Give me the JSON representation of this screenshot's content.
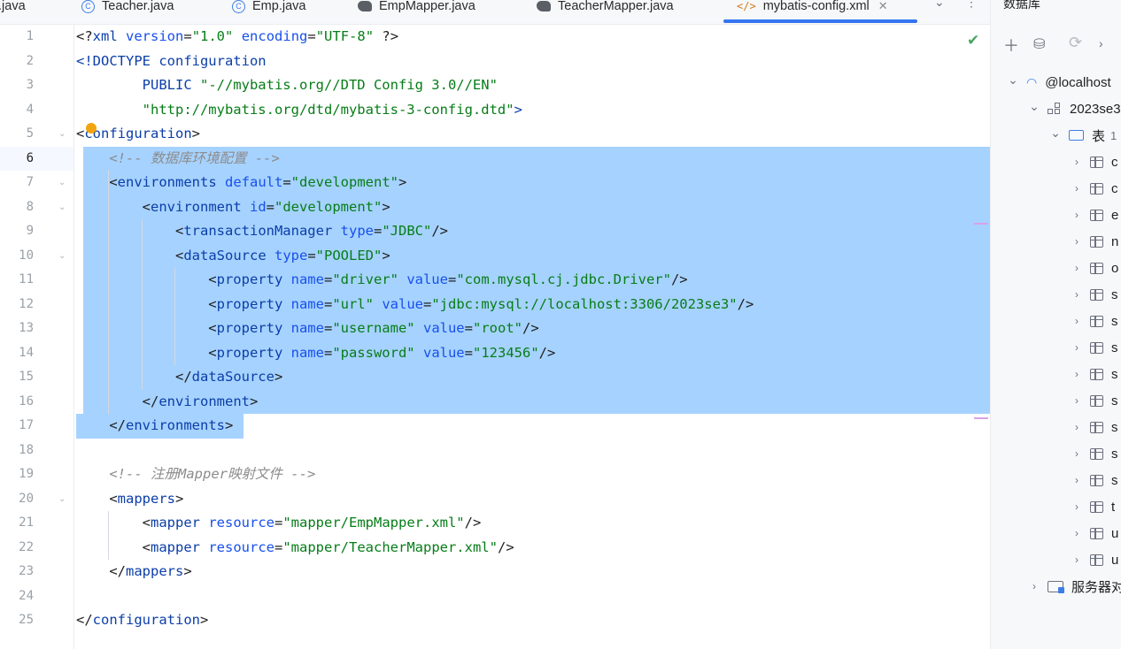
{
  "tabs": [
    {
      "label": "t.java",
      "icon": "java-class-icon"
    },
    {
      "label": "Teacher.java",
      "icon": "class-icon"
    },
    {
      "label": "Emp.java",
      "icon": "class-icon"
    },
    {
      "label": "EmpMapper.java",
      "icon": "mybatis-icon"
    },
    {
      "label": "TeacherMapper.java",
      "icon": "mybatis-icon"
    },
    {
      "label": "mybatis-config.xml",
      "icon": "xml-icon",
      "active": true
    }
  ],
  "code": [
    {
      "n": "1",
      "tokens": [
        [
          "t-tag",
          "<?"
        ],
        [
          "t-name",
          "xml"
        ],
        [
          "t-tag",
          " "
        ],
        [
          "t-attr",
          "version"
        ],
        [
          "t-tag",
          "="
        ],
        [
          "t-val",
          "\"1.0\""
        ],
        [
          "t-tag",
          " "
        ],
        [
          "t-attr",
          "encoding"
        ],
        [
          "t-tag",
          "="
        ],
        [
          "t-val",
          "\"UTF-8\""
        ],
        [
          "t-tag",
          " ?>"
        ]
      ]
    },
    {
      "n": "2",
      "tokens": [
        [
          "t-name",
          "<!DOCTYPE configuration"
        ]
      ]
    },
    {
      "n": "3",
      "tokens": [
        [
          "t-name",
          "        PUBLIC "
        ],
        [
          "t-val",
          "\"-//mybatis.org//DTD Config 3.0//EN\""
        ]
      ]
    },
    {
      "n": "4",
      "tokens": [
        [
          "t-tag",
          "        "
        ],
        [
          "t-val",
          "\"http://mybatis.org/dtd/mybatis-3-config.dtd\""
        ],
        [
          "t-name",
          ">"
        ]
      ]
    },
    {
      "n": "5",
      "tokens": [
        [
          "t-tag",
          "<"
        ],
        [
          "t-name",
          "configuration"
        ],
        [
          "t-tag",
          ">"
        ]
      ]
    },
    {
      "n": "6",
      "tokens": [
        [
          "t-com",
          "    <!-- 数据库环境配置 -->"
        ]
      ]
    },
    {
      "n": "7",
      "tokens": [
        [
          "t-tag",
          "    <"
        ],
        [
          "t-name",
          "environments"
        ],
        [
          "t-tag",
          " "
        ],
        [
          "t-attr",
          "default"
        ],
        [
          "t-tag",
          "="
        ],
        [
          "t-val",
          "\"development\""
        ],
        [
          "t-tag",
          ">"
        ]
      ]
    },
    {
      "n": "8",
      "tokens": [
        [
          "t-tag",
          "        <"
        ],
        [
          "t-name",
          "environment"
        ],
        [
          "t-tag",
          " "
        ],
        [
          "t-attr",
          "id"
        ],
        [
          "t-tag",
          "="
        ],
        [
          "t-val",
          "\"development\""
        ],
        [
          "t-tag",
          ">"
        ]
      ]
    },
    {
      "n": "9",
      "tokens": [
        [
          "t-tag",
          "            <"
        ],
        [
          "t-name",
          "transactionManager"
        ],
        [
          "t-tag",
          " "
        ],
        [
          "t-attr",
          "type"
        ],
        [
          "t-tag",
          "="
        ],
        [
          "t-val",
          "\"JDBC\""
        ],
        [
          "t-tag",
          "/>"
        ]
      ]
    },
    {
      "n": "10",
      "tokens": [
        [
          "t-tag",
          "            <"
        ],
        [
          "t-name",
          "dataSource"
        ],
        [
          "t-tag",
          " "
        ],
        [
          "t-attr",
          "type"
        ],
        [
          "t-tag",
          "="
        ],
        [
          "t-val",
          "\"POOLED\""
        ],
        [
          "t-tag",
          ">"
        ]
      ]
    },
    {
      "n": "11",
      "tokens": [
        [
          "t-tag",
          "                <"
        ],
        [
          "t-name",
          "property"
        ],
        [
          "t-tag",
          " "
        ],
        [
          "t-attr",
          "name"
        ],
        [
          "t-tag",
          "="
        ],
        [
          "t-val",
          "\"driver\""
        ],
        [
          "t-tag",
          " "
        ],
        [
          "t-attr",
          "value"
        ],
        [
          "t-tag",
          "="
        ],
        [
          "t-val",
          "\"com.mysql.cj.jdbc.Driver\""
        ],
        [
          "t-tag",
          "/>"
        ]
      ]
    },
    {
      "n": "12",
      "tokens": [
        [
          "t-tag",
          "                <"
        ],
        [
          "t-name",
          "property"
        ],
        [
          "t-tag",
          " "
        ],
        [
          "t-attr",
          "name"
        ],
        [
          "t-tag",
          "="
        ],
        [
          "t-val",
          "\"url\""
        ],
        [
          "t-tag",
          " "
        ],
        [
          "t-attr",
          "value"
        ],
        [
          "t-tag",
          "="
        ],
        [
          "t-val",
          "\"jdbc:mysql://localhost:3306/2023se3\""
        ],
        [
          "t-tag",
          "/>"
        ]
      ]
    },
    {
      "n": "13",
      "tokens": [
        [
          "t-tag",
          "                <"
        ],
        [
          "t-name",
          "property"
        ],
        [
          "t-tag",
          " "
        ],
        [
          "t-attr",
          "name"
        ],
        [
          "t-tag",
          "="
        ],
        [
          "t-val",
          "\"username\""
        ],
        [
          "t-tag",
          " "
        ],
        [
          "t-attr",
          "value"
        ],
        [
          "t-tag",
          "="
        ],
        [
          "t-val",
          "\"root\""
        ],
        [
          "t-tag",
          "/>"
        ]
      ]
    },
    {
      "n": "14",
      "tokens": [
        [
          "t-tag",
          "                <"
        ],
        [
          "t-name",
          "property"
        ],
        [
          "t-tag",
          " "
        ],
        [
          "t-attr",
          "name"
        ],
        [
          "t-tag",
          "="
        ],
        [
          "t-val",
          "\"password\""
        ],
        [
          "t-tag",
          " "
        ],
        [
          "t-attr",
          "value"
        ],
        [
          "t-tag",
          "="
        ],
        [
          "t-val",
          "\"123456\""
        ],
        [
          "t-tag",
          "/>"
        ]
      ]
    },
    {
      "n": "15",
      "tokens": [
        [
          "t-tag",
          "            </"
        ],
        [
          "t-name",
          "dataSource"
        ],
        [
          "t-tag",
          ">"
        ]
      ]
    },
    {
      "n": "16",
      "tokens": [
        [
          "t-tag",
          "        </"
        ],
        [
          "t-name",
          "environment"
        ],
        [
          "t-tag",
          ">"
        ]
      ]
    },
    {
      "n": "17",
      "tokens": [
        [
          "t-tag",
          "    </"
        ],
        [
          "t-name",
          "environments"
        ],
        [
          "t-tag",
          ">"
        ]
      ]
    },
    {
      "n": "18",
      "tokens": []
    },
    {
      "n": "19",
      "tokens": [
        [
          "t-com",
          "    <!-- 注册Mapper映射文件 -->"
        ]
      ]
    },
    {
      "n": "20",
      "tokens": [
        [
          "t-tag",
          "    <"
        ],
        [
          "t-name",
          "mappers"
        ],
        [
          "t-tag",
          ">"
        ]
      ]
    },
    {
      "n": "21",
      "tokens": [
        [
          "t-tag",
          "        <"
        ],
        [
          "t-name",
          "mapper"
        ],
        [
          "t-tag",
          " "
        ],
        [
          "t-attr",
          "resource"
        ],
        [
          "t-tag",
          "="
        ],
        [
          "t-val",
          "\"mapper/EmpMapper.xml\""
        ],
        [
          "t-tag",
          "/>"
        ]
      ]
    },
    {
      "n": "22",
      "tokens": [
        [
          "t-tag",
          "        <"
        ],
        [
          "t-name",
          "mapper"
        ],
        [
          "t-tag",
          " "
        ],
        [
          "t-attr",
          "resource"
        ],
        [
          "t-tag",
          "="
        ],
        [
          "t-val",
          "\"mapper/TeacherMapper.xml\""
        ],
        [
          "t-tag",
          "/>"
        ]
      ]
    },
    {
      "n": "23",
      "tokens": [
        [
          "t-tag",
          "    </"
        ],
        [
          "t-name",
          "mappers"
        ],
        [
          "t-tag",
          ">"
        ]
      ]
    },
    {
      "n": "24",
      "tokens": []
    },
    {
      "n": "25",
      "tokens": [
        [
          "t-tag",
          "</"
        ],
        [
          "t-name",
          "configuration"
        ],
        [
          "t-tag",
          ">"
        ]
      ]
    }
  ],
  "current_line": 6,
  "fold_lines": [
    5,
    7,
    8,
    10,
    20
  ],
  "db_panel": {
    "title": "数据库",
    "tree": [
      {
        "label": "@localhost",
        "level": 0,
        "icon": "mysql-icon",
        "expanded": true
      },
      {
        "label": "2023se3",
        "level": 1,
        "icon": "schema-icon",
        "expanded": true
      },
      {
        "label": "表",
        "count": "1",
        "level": 2,
        "icon": "folder-icon",
        "expanded": true
      },
      {
        "label": "c",
        "level": 3,
        "icon": "table-icon"
      },
      {
        "label": "c",
        "level": 3,
        "icon": "table-icon"
      },
      {
        "label": "e",
        "level": 3,
        "icon": "table-icon"
      },
      {
        "label": "n",
        "level": 3,
        "icon": "table-icon"
      },
      {
        "label": "o",
        "level": 3,
        "icon": "table-icon"
      },
      {
        "label": "s",
        "level": 3,
        "icon": "table-icon"
      },
      {
        "label": "s",
        "level": 3,
        "icon": "table-icon"
      },
      {
        "label": "s",
        "level": 3,
        "icon": "table-icon"
      },
      {
        "label": "s",
        "level": 3,
        "icon": "table-icon"
      },
      {
        "label": "s",
        "level": 3,
        "icon": "table-icon"
      },
      {
        "label": "s",
        "level": 3,
        "icon": "table-icon"
      },
      {
        "label": "s",
        "level": 3,
        "icon": "table-icon"
      },
      {
        "label": "s",
        "level": 3,
        "icon": "table-icon"
      },
      {
        "label": "t",
        "level": 3,
        "icon": "table-icon"
      },
      {
        "label": "u",
        "level": 3,
        "icon": "table-icon"
      },
      {
        "label": "u",
        "level": 3,
        "icon": "table-icon"
      },
      {
        "label": "服务器对",
        "level": 1,
        "icon": "server-objects-icon"
      }
    ]
  },
  "colors": {
    "selection": "#a6d2ff",
    "tag_name": "#0b3ea8",
    "attr": "#1750eb",
    "value": "#067d17",
    "comment": "#8c8c8c",
    "accent": "#3574f0"
  }
}
